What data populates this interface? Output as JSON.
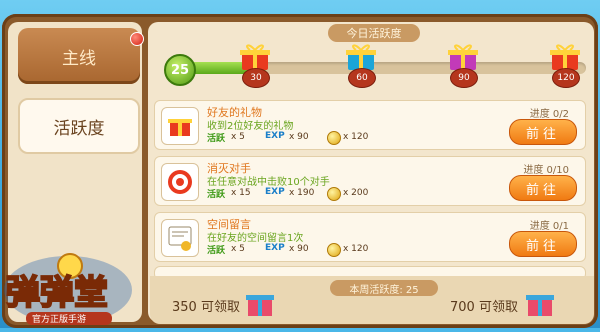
{
  "tabs": [
    {
      "label": "主线",
      "selected": false,
      "has_dot": true
    },
    {
      "label": "活跃度",
      "selected": true,
      "has_dot": false
    }
  ],
  "activity": {
    "title": "今日活跃度",
    "current": "25",
    "progress_fraction": 0.22,
    "milestones": [
      {
        "value": "30",
        "color": "#e93a1f"
      },
      {
        "value": "60",
        "color": "#1ba5d8"
      },
      {
        "value": "90",
        "color": "#c23ab8"
      },
      {
        "value": "120",
        "color": "#e93a1f"
      }
    ]
  },
  "tasks": [
    {
      "name": "好友的礼物",
      "desc": "收到2位好友的礼物",
      "act": "x 5",
      "exp": "x 90",
      "coin": "x 120",
      "progress": "进度 0/2",
      "button": "前往",
      "icon": "gift-icon"
    },
    {
      "name": "消灭对手",
      "desc": "在任意对战中击败10个对手",
      "act": "x 15",
      "exp": "x 190",
      "coin": "x 200",
      "progress": "进度 0/10",
      "button": "前往",
      "icon": "target-icon"
    },
    {
      "name": "空间留言",
      "desc": "在好友的空间留言1次",
      "act": "x 5",
      "exp": "x 90",
      "coin": "x 120",
      "progress": "进度 0/1",
      "button": "前往",
      "icon": "message-icon"
    }
  ],
  "labels": {
    "act": "活跃",
    "exp": "EXP"
  },
  "weekly": {
    "title": "本周活跃度: 25",
    "claims": [
      {
        "amount": "350",
        "label": "可领取"
      },
      {
        "amount": "700",
        "label": "可领取"
      }
    ]
  },
  "logo": {
    "text": "弹弹堂",
    "subtitle": "官方正版手游"
  }
}
